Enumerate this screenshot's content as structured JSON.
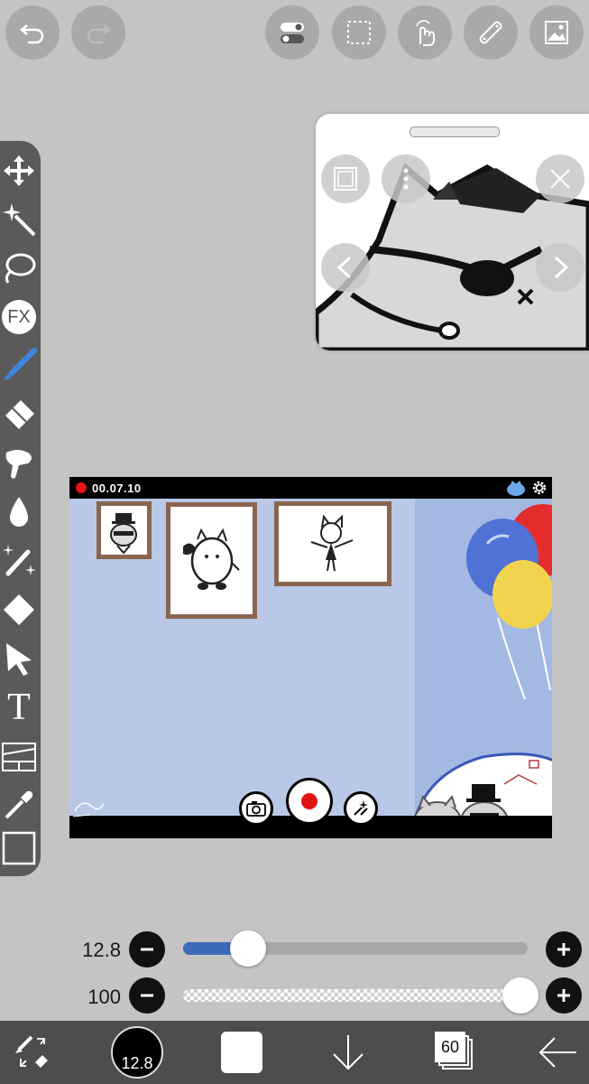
{
  "top_toolbar": {
    "icons": [
      "undo-icon",
      "redo-icon",
      "toggle-settings-icon",
      "selection-icon",
      "touch-icon",
      "ruler-icon",
      "image-icon"
    ]
  },
  "left_toolbar": {
    "tools": [
      "move-tool-icon",
      "magic-wand-icon",
      "lasso-icon",
      "fx-icon",
      "brush-icon",
      "eraser-icon",
      "smudge-icon",
      "bucket-icon",
      "effects-icon",
      "fill-shape-icon",
      "select-arrow-icon",
      "text-tool-icon",
      "frame-divider-icon",
      "eyedropper-icon",
      "layer-canvas-icon"
    ],
    "fx_label": "FX",
    "text_label": "T",
    "active_color": "#3d86e0"
  },
  "recording": {
    "time": "00.07.10"
  },
  "sliders": {
    "brush_size": "12.8",
    "opacity": "100",
    "size_fraction": 0.19,
    "opacity_fraction": 1.0,
    "fill_color": "#3d6ab8"
  },
  "bottom_bar": {
    "brush_size_value": "12.8",
    "layers_count": "60",
    "icons": [
      "brush-settings-icon",
      "brush-size-icon",
      "color-swatch-icon",
      "import-down-icon",
      "layers-icon",
      "back-arrow-icon"
    ]
  }
}
